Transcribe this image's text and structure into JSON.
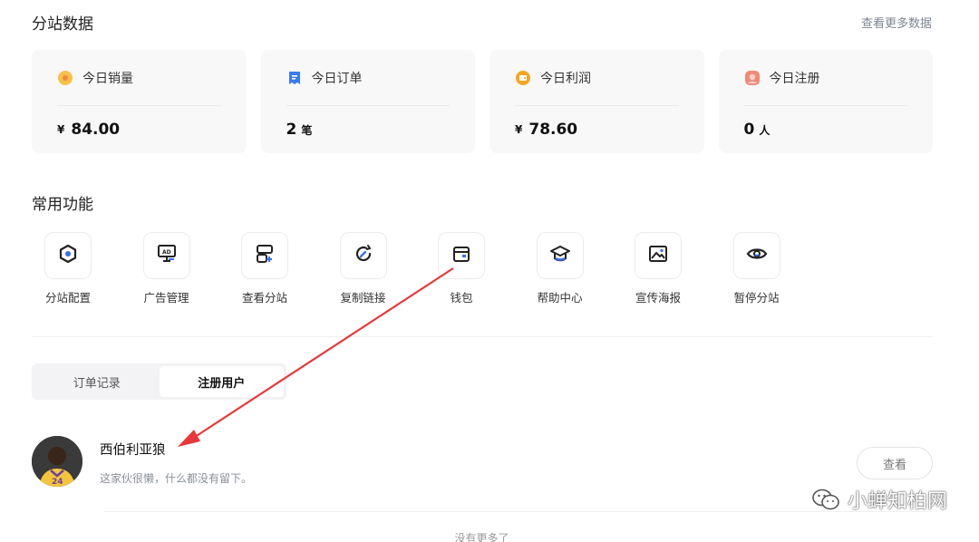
{
  "header": {
    "title": "分站数据",
    "more_label": "查看更多数据"
  },
  "stats": [
    {
      "label": "今日销量",
      "currency": "¥",
      "value": "84.00",
      "unit": "",
      "icon": "sales-icon"
    },
    {
      "label": "今日订单",
      "currency": "",
      "value": "2",
      "unit": "笔",
      "icon": "order-icon"
    },
    {
      "label": "今日利润",
      "currency": "¥",
      "value": "78.60",
      "unit": "",
      "icon": "profit-icon"
    },
    {
      "label": "今日注册",
      "currency": "",
      "value": "0",
      "unit": "人",
      "icon": "register-icon"
    }
  ],
  "features": {
    "title": "常用功能",
    "items": [
      {
        "label": "分站配置",
        "icon": "hexagon-settings-icon"
      },
      {
        "label": "广告管理",
        "icon": "ad-board-icon"
      },
      {
        "label": "查看分站",
        "icon": "site-view-icon"
      },
      {
        "label": "复制链接",
        "icon": "copy-link-icon"
      },
      {
        "label": "钱包",
        "icon": "wallet-icon"
      },
      {
        "label": "帮助中心",
        "icon": "graduation-cap-icon"
      },
      {
        "label": "宣传海报",
        "icon": "poster-image-icon"
      },
      {
        "label": "暂停分站",
        "icon": "eye-pause-icon"
      }
    ]
  },
  "tabs": [
    {
      "label": "订单记录",
      "active": false
    },
    {
      "label": "注册用户",
      "active": true
    }
  ],
  "user": {
    "name": "西伯利亚狼",
    "description": "这家伙很懒，什么都没有留下。",
    "view_label": "查看"
  },
  "footer": {
    "no_more": "没有更多了"
  },
  "watermark": {
    "text": "小蝉知柏网"
  },
  "colors": {
    "accent": "#3b6cf6",
    "annotation_arrow": "#e8383b"
  }
}
